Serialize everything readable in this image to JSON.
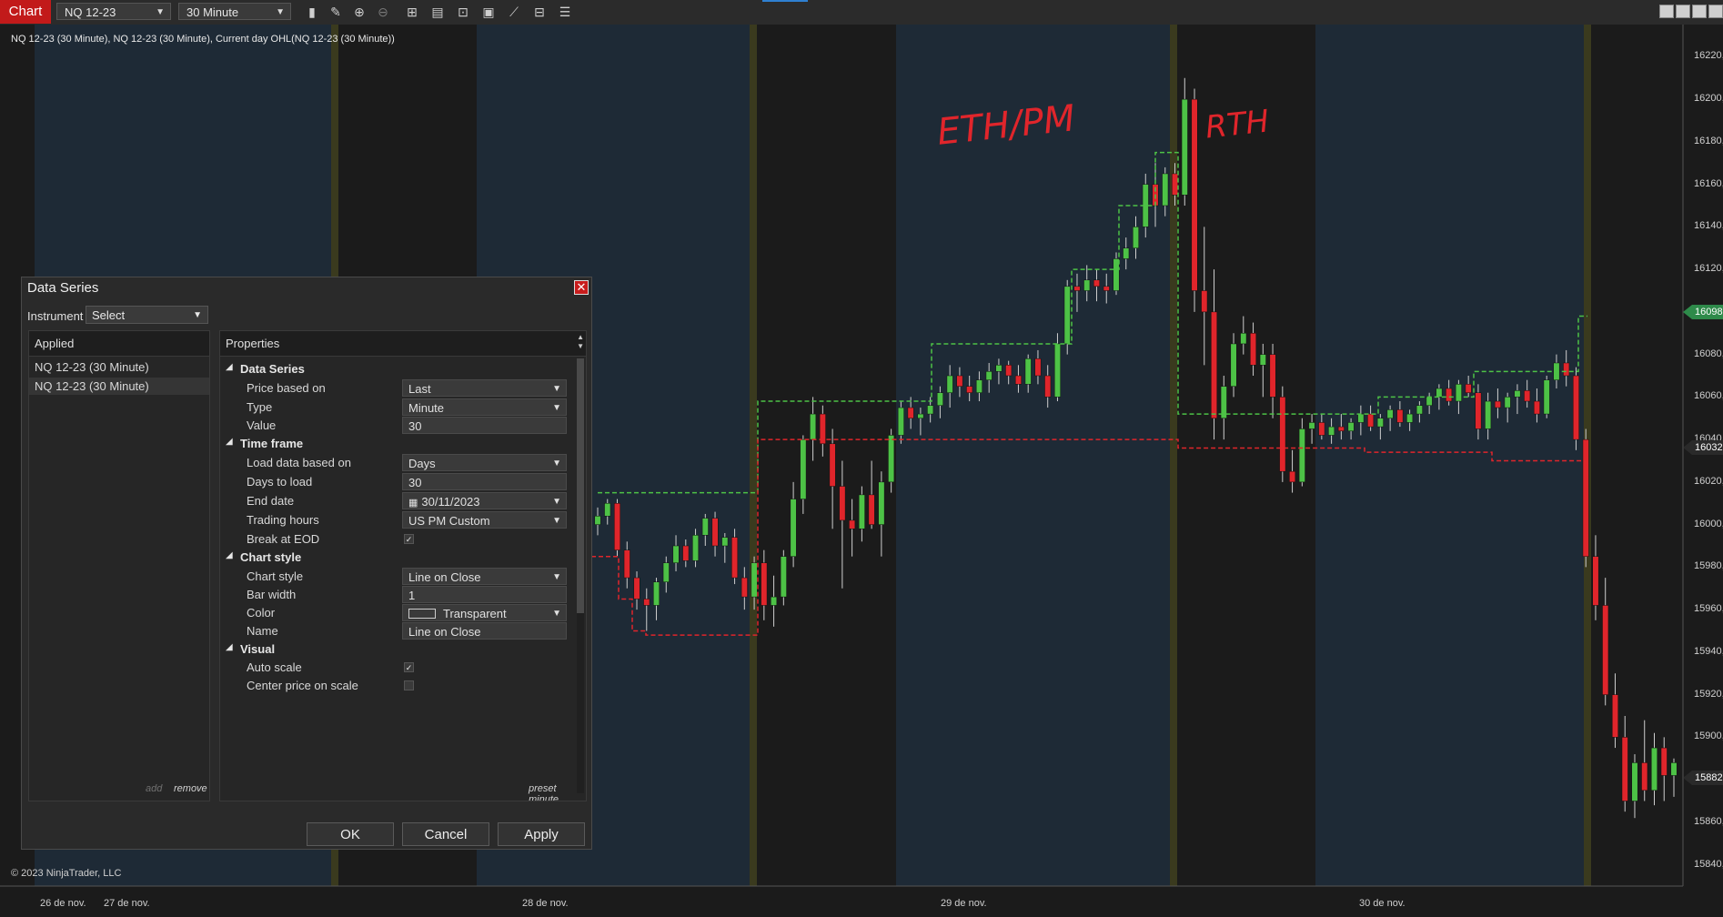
{
  "toolbar": {
    "tab_label": "Chart",
    "instrument": "NQ 12-23",
    "interval": "30 Minute",
    "icons": [
      "bars-type-icon",
      "pencil-icon",
      "zoom-in-icon",
      "zoom-out-icon",
      "crosshair-icon",
      "properties-icon",
      "templates-icon",
      "screenshot-icon",
      "indicators-icon",
      "strategies-icon",
      "data-series-list-icon"
    ]
  },
  "chart": {
    "series_label": "NQ 12-23 (30 Minute), NQ 12-23 (30 Minute), Current day OHL(NQ 12-23 (30 Minute))",
    "copyright": "© 2023 NinjaTrader, LLC",
    "annotations": {
      "eth": "ETH/PM",
      "rth": "RTH"
    },
    "price_tags": {
      "high": "16098,",
      "mid": "16032,",
      "last": "15882,"
    },
    "colors": {
      "up": "#4dc246",
      "down": "#e0252b",
      "session_blue": "#1e2a36",
      "session_dark": "#1b1b1b",
      "separator": "#3a3a1e"
    }
  },
  "chart_data": {
    "type": "candlestick",
    "instrument": "NQ 12-23",
    "interval": "30 Minute",
    "ylim": [
      15830,
      16230
    ],
    "y_ticks": [
      15840,
      15860,
      15880,
      15900,
      15920,
      15940,
      15960,
      15980,
      16000,
      16020,
      16040,
      16060,
      16080,
      16100,
      16120,
      16140,
      16160,
      16180,
      16200,
      16220
    ],
    "y_tick_labels": [
      "15840,",
      "15860,",
      "15880,",
      "15900,",
      "15920,",
      "15940,",
      "15960,",
      "15980,",
      "16000,",
      "16020,",
      "16040,",
      "16060,",
      "16080,",
      "16100,",
      "16120,",
      "16140,",
      "16160,",
      "16180,",
      "16200,",
      "16220,"
    ],
    "x_tick_labels": [
      "26 de nov.",
      "27 de nov.",
      "28 de nov.",
      "29 de nov.",
      "30 de nov."
    ],
    "candles": [
      [
        16000,
        16008,
        15995,
        16004
      ],
      [
        16004,
        16012,
        16000,
        16010
      ],
      [
        16010,
        16012,
        15985,
        15988
      ],
      [
        15988,
        15992,
        15970,
        15975
      ],
      [
        15975,
        15978,
        15960,
        15965
      ],
      [
        15965,
        15970,
        15950,
        15962
      ],
      [
        15962,
        15975,
        15955,
        15973
      ],
      [
        15973,
        15985,
        15968,
        15982
      ],
      [
        15982,
        15995,
        15978,
        15990
      ],
      [
        15990,
        15993,
        15980,
        15983
      ],
      [
        15983,
        15998,
        15980,
        15995
      ],
      [
        15995,
        16005,
        15990,
        16003
      ],
      [
        16003,
        16006,
        15985,
        15990
      ],
      [
        15990,
        15996,
        15982,
        15994
      ],
      [
        15994,
        15998,
        15972,
        15975
      ],
      [
        15975,
        15980,
        15960,
        15966
      ],
      [
        15966,
        15985,
        15960,
        15982
      ],
      [
        15982,
        15988,
        15955,
        15962
      ],
      [
        15962,
        15976,
        15952,
        15966
      ],
      [
        15966,
        15988,
        15962,
        15985
      ],
      [
        15985,
        16020,
        15980,
        16012
      ],
      [
        16012,
        16042,
        16005,
        16040
      ],
      [
        16040,
        16060,
        16030,
        16052
      ],
      [
        16052,
        16056,
        16032,
        16038
      ],
      [
        16038,
        16045,
        15998,
        16018
      ],
      [
        16018,
        16030,
        15970,
        16002
      ],
      [
        16002,
        16012,
        15985,
        15998
      ],
      [
        15998,
        16018,
        15992,
        16014
      ],
      [
        16014,
        16030,
        15998,
        16000
      ],
      [
        16000,
        16025,
        15985,
        16020
      ],
      [
        16020,
        16045,
        16015,
        16042
      ],
      [
        16042,
        16058,
        16038,
        16055
      ],
      [
        16055,
        16060,
        16045,
        16050
      ],
      [
        16050,
        16055,
        16042,
        16052
      ],
      [
        16052,
        16060,
        16048,
        16056
      ],
      [
        16056,
        16065,
        16050,
        16062
      ],
      [
        16062,
        16075,
        16055,
        16070
      ],
      [
        16070,
        16074,
        16060,
        16065
      ],
      [
        16065,
        16070,
        16058,
        16062
      ],
      [
        16062,
        16072,
        16058,
        16068
      ],
      [
        16068,
        16076,
        16062,
        16072
      ],
      [
        16072,
        16078,
        16066,
        16075
      ],
      [
        16075,
        16077,
        16066,
        16070
      ],
      [
        16070,
        16075,
        16062,
        16066
      ],
      [
        16066,
        16080,
        16062,
        16078
      ],
      [
        16078,
        16082,
        16066,
        16070
      ],
      [
        16070,
        16075,
        16055,
        16060
      ],
      [
        16060,
        16090,
        16058,
        16085
      ],
      [
        16085,
        16115,
        16080,
        16112
      ],
      [
        16112,
        16118,
        16100,
        16110
      ],
      [
        16110,
        16122,
        16105,
        16115
      ],
      [
        16115,
        16120,
        16105,
        16112
      ],
      [
        16112,
        16118,
        16104,
        16110
      ],
      [
        16110,
        16128,
        16108,
        16125
      ],
      [
        16125,
        16135,
        16120,
        16130
      ],
      [
        16130,
        16145,
        16125,
        16140
      ],
      [
        16140,
        16165,
        16135,
        16160
      ],
      [
        16160,
        16170,
        16140,
        16150
      ],
      [
        16150,
        16168,
        16145,
        16165
      ],
      [
        16165,
        16170,
        16150,
        16155
      ],
      [
        16155,
        16210,
        16150,
        16200
      ],
      [
        16200,
        16205,
        16100,
        16110
      ],
      [
        16110,
        16140,
        16075,
        16100
      ],
      [
        16100,
        16120,
        16040,
        16050
      ],
      [
        16050,
        16070,
        16040,
        16065
      ],
      [
        16065,
        16090,
        16060,
        16085
      ],
      [
        16085,
        16098,
        16080,
        16090
      ],
      [
        16090,
        16095,
        16070,
        16075
      ],
      [
        16075,
        16085,
        16060,
        16080
      ],
      [
        16080,
        16085,
        16050,
        16060
      ],
      [
        16060,
        16065,
        16020,
        16025
      ],
      [
        16025,
        16035,
        16015,
        16020
      ],
      [
        16020,
        16050,
        16018,
        16045
      ],
      [
        16045,
        16052,
        16038,
        16048
      ],
      [
        16048,
        16052,
        16040,
        16042
      ],
      [
        16042,
        16050,
        16038,
        16046
      ],
      [
        16046,
        16052,
        16040,
        16044
      ],
      [
        16044,
        16050,
        16040,
        16048
      ],
      [
        16048,
        16056,
        16042,
        16052
      ],
      [
        16052,
        16056,
        16044,
        16046
      ],
      [
        16046,
        16052,
        16040,
        16050
      ],
      [
        16050,
        16056,
        16044,
        16054
      ],
      [
        16054,
        16058,
        16046,
        16048
      ],
      [
        16048,
        16054,
        16044,
        16052
      ],
      [
        16052,
        16058,
        16048,
        16056
      ],
      [
        16056,
        16062,
        16052,
        16060
      ],
      [
        16060,
        16066,
        16054,
        16064
      ],
      [
        16064,
        16068,
        16056,
        16058
      ],
      [
        16058,
        16068,
        16052,
        16066
      ],
      [
        16066,
        16070,
        16060,
        16062
      ],
      [
        16062,
        16066,
        16040,
        16045
      ],
      [
        16045,
        16062,
        16040,
        16058
      ],
      [
        16058,
        16064,
        16050,
        16055
      ],
      [
        16055,
        16062,
        16048,
        16060
      ],
      [
        16060,
        16066,
        16052,
        16063
      ],
      [
        16063,
        16068,
        16055,
        16058
      ],
      [
        16058,
        16064,
        16048,
        16052
      ],
      [
        16052,
        16070,
        16050,
        16068
      ],
      [
        16068,
        16080,
        16064,
        16076
      ],
      [
        16076,
        16082,
        16065,
        16070
      ],
      [
        16070,
        16074,
        16035,
        16040
      ],
      [
        16040,
        16045,
        15980,
        15985
      ],
      [
        15985,
        15995,
        15955,
        15962
      ],
      [
        15962,
        15975,
        15915,
        15920
      ],
      [
        15920,
        15930,
        15895,
        15900
      ],
      [
        15900,
        15910,
        15865,
        15870
      ],
      [
        15870,
        15892,
        15862,
        15888
      ],
      [
        15888,
        15908,
        15870,
        15875
      ],
      [
        15875,
        15902,
        15868,
        15895
      ],
      [
        15895,
        15900,
        15870,
        15882
      ],
      [
        15882,
        15890,
        15872,
        15888
      ]
    ]
  },
  "dialog": {
    "title": "Data Series",
    "instrument_label": "Instrument",
    "instrument_select": "Select",
    "applied_header": "Applied",
    "applied_items": [
      "NQ 12-23 (30 Minute)",
      "NQ 12-23 (30 Minute)"
    ],
    "add_label": "add",
    "remove_label": "remove",
    "properties_header": "Properties",
    "preset_label": "preset minute",
    "categories": {
      "data_series": "Data Series",
      "time_frame": "Time frame",
      "chart_style": "Chart style",
      "visual": "Visual"
    },
    "props": {
      "price_based_on": {
        "label": "Price based on",
        "value": "Last"
      },
      "type": {
        "label": "Type",
        "value": "Minute"
      },
      "value": {
        "label": "Value",
        "value": "30"
      },
      "load_data_based_on": {
        "label": "Load data based on",
        "value": "Days"
      },
      "days_to_load": {
        "label": "Days to load",
        "value": "30"
      },
      "end_date": {
        "label": "End date",
        "value": "30/11/2023"
      },
      "trading_hours": {
        "label": "Trading hours",
        "value": "US PM Custom"
      },
      "break_at_eod": {
        "label": "Break at EOD",
        "checked": true
      },
      "chart_style": {
        "label": "Chart style",
        "value": "Line on Close"
      },
      "bar_width": {
        "label": "Bar width",
        "value": "1"
      },
      "color": {
        "label": "Color",
        "value": "Transparent"
      },
      "name": {
        "label": "Name",
        "value": "Line on Close"
      },
      "auto_scale": {
        "label": "Auto scale",
        "checked": true
      },
      "center_price": {
        "label": "Center price on scale",
        "checked": false
      }
    },
    "buttons": {
      "ok": "OK",
      "cancel": "Cancel",
      "apply": "Apply"
    }
  }
}
